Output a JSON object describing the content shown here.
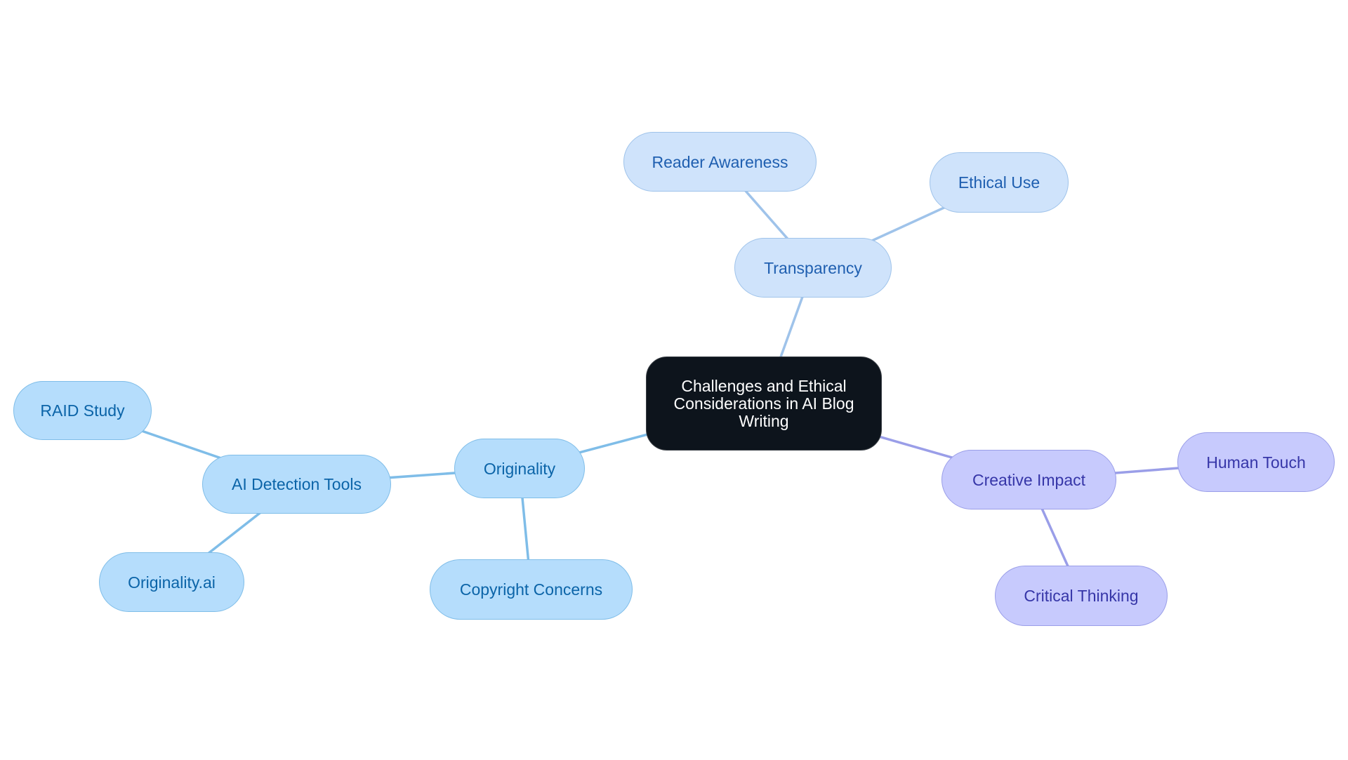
{
  "diagram": {
    "type": "mindmap",
    "root": {
      "id": "root",
      "label": "Challenges and Ethical Considerations in AI Blog Writing"
    },
    "branches": [
      {
        "id": "transparency",
        "label": "Transparency",
        "color": "#cfe3fb",
        "edge_color": "#9fc3ea",
        "children": [
          {
            "id": "reader",
            "label": "Reader Awareness"
          },
          {
            "id": "ethical",
            "label": "Ethical Use"
          }
        ]
      },
      {
        "id": "originality",
        "label": "Originality",
        "color": "#b5ddfc",
        "edge_color": "#7fbde8",
        "children": [
          {
            "id": "aidetect",
            "label": "AI Detection Tools",
            "children": [
              {
                "id": "raid",
                "label": "RAID Study"
              },
              {
                "id": "origai",
                "label": "Originality.ai"
              }
            ]
          },
          {
            "id": "copyright",
            "label": "Copyright Concerns"
          }
        ]
      },
      {
        "id": "creative",
        "label": "Creative Impact",
        "color": "#c7cafd",
        "edge_color": "#9a9ee8",
        "children": [
          {
            "id": "human",
            "label": "Human Touch"
          },
          {
            "id": "critical",
            "label": "Critical Thinking"
          }
        ]
      }
    ],
    "edges": [
      {
        "from": "root",
        "to": "transparency",
        "branch": 0
      },
      {
        "from": "transparency",
        "to": "reader",
        "branch": 0
      },
      {
        "from": "transparency",
        "to": "ethical",
        "branch": 0
      },
      {
        "from": "root",
        "to": "originality",
        "branch": 1
      },
      {
        "from": "originality",
        "to": "aidetect",
        "branch": 1
      },
      {
        "from": "aidetect",
        "to": "raid",
        "branch": 1
      },
      {
        "from": "aidetect",
        "to": "origai",
        "branch": 1
      },
      {
        "from": "originality",
        "to": "copyright",
        "branch": 1
      },
      {
        "from": "root",
        "to": "creative",
        "branch": 2
      },
      {
        "from": "creative",
        "to": "human",
        "branch": 2
      },
      {
        "from": "creative",
        "to": "critical",
        "branch": 2
      }
    ]
  }
}
